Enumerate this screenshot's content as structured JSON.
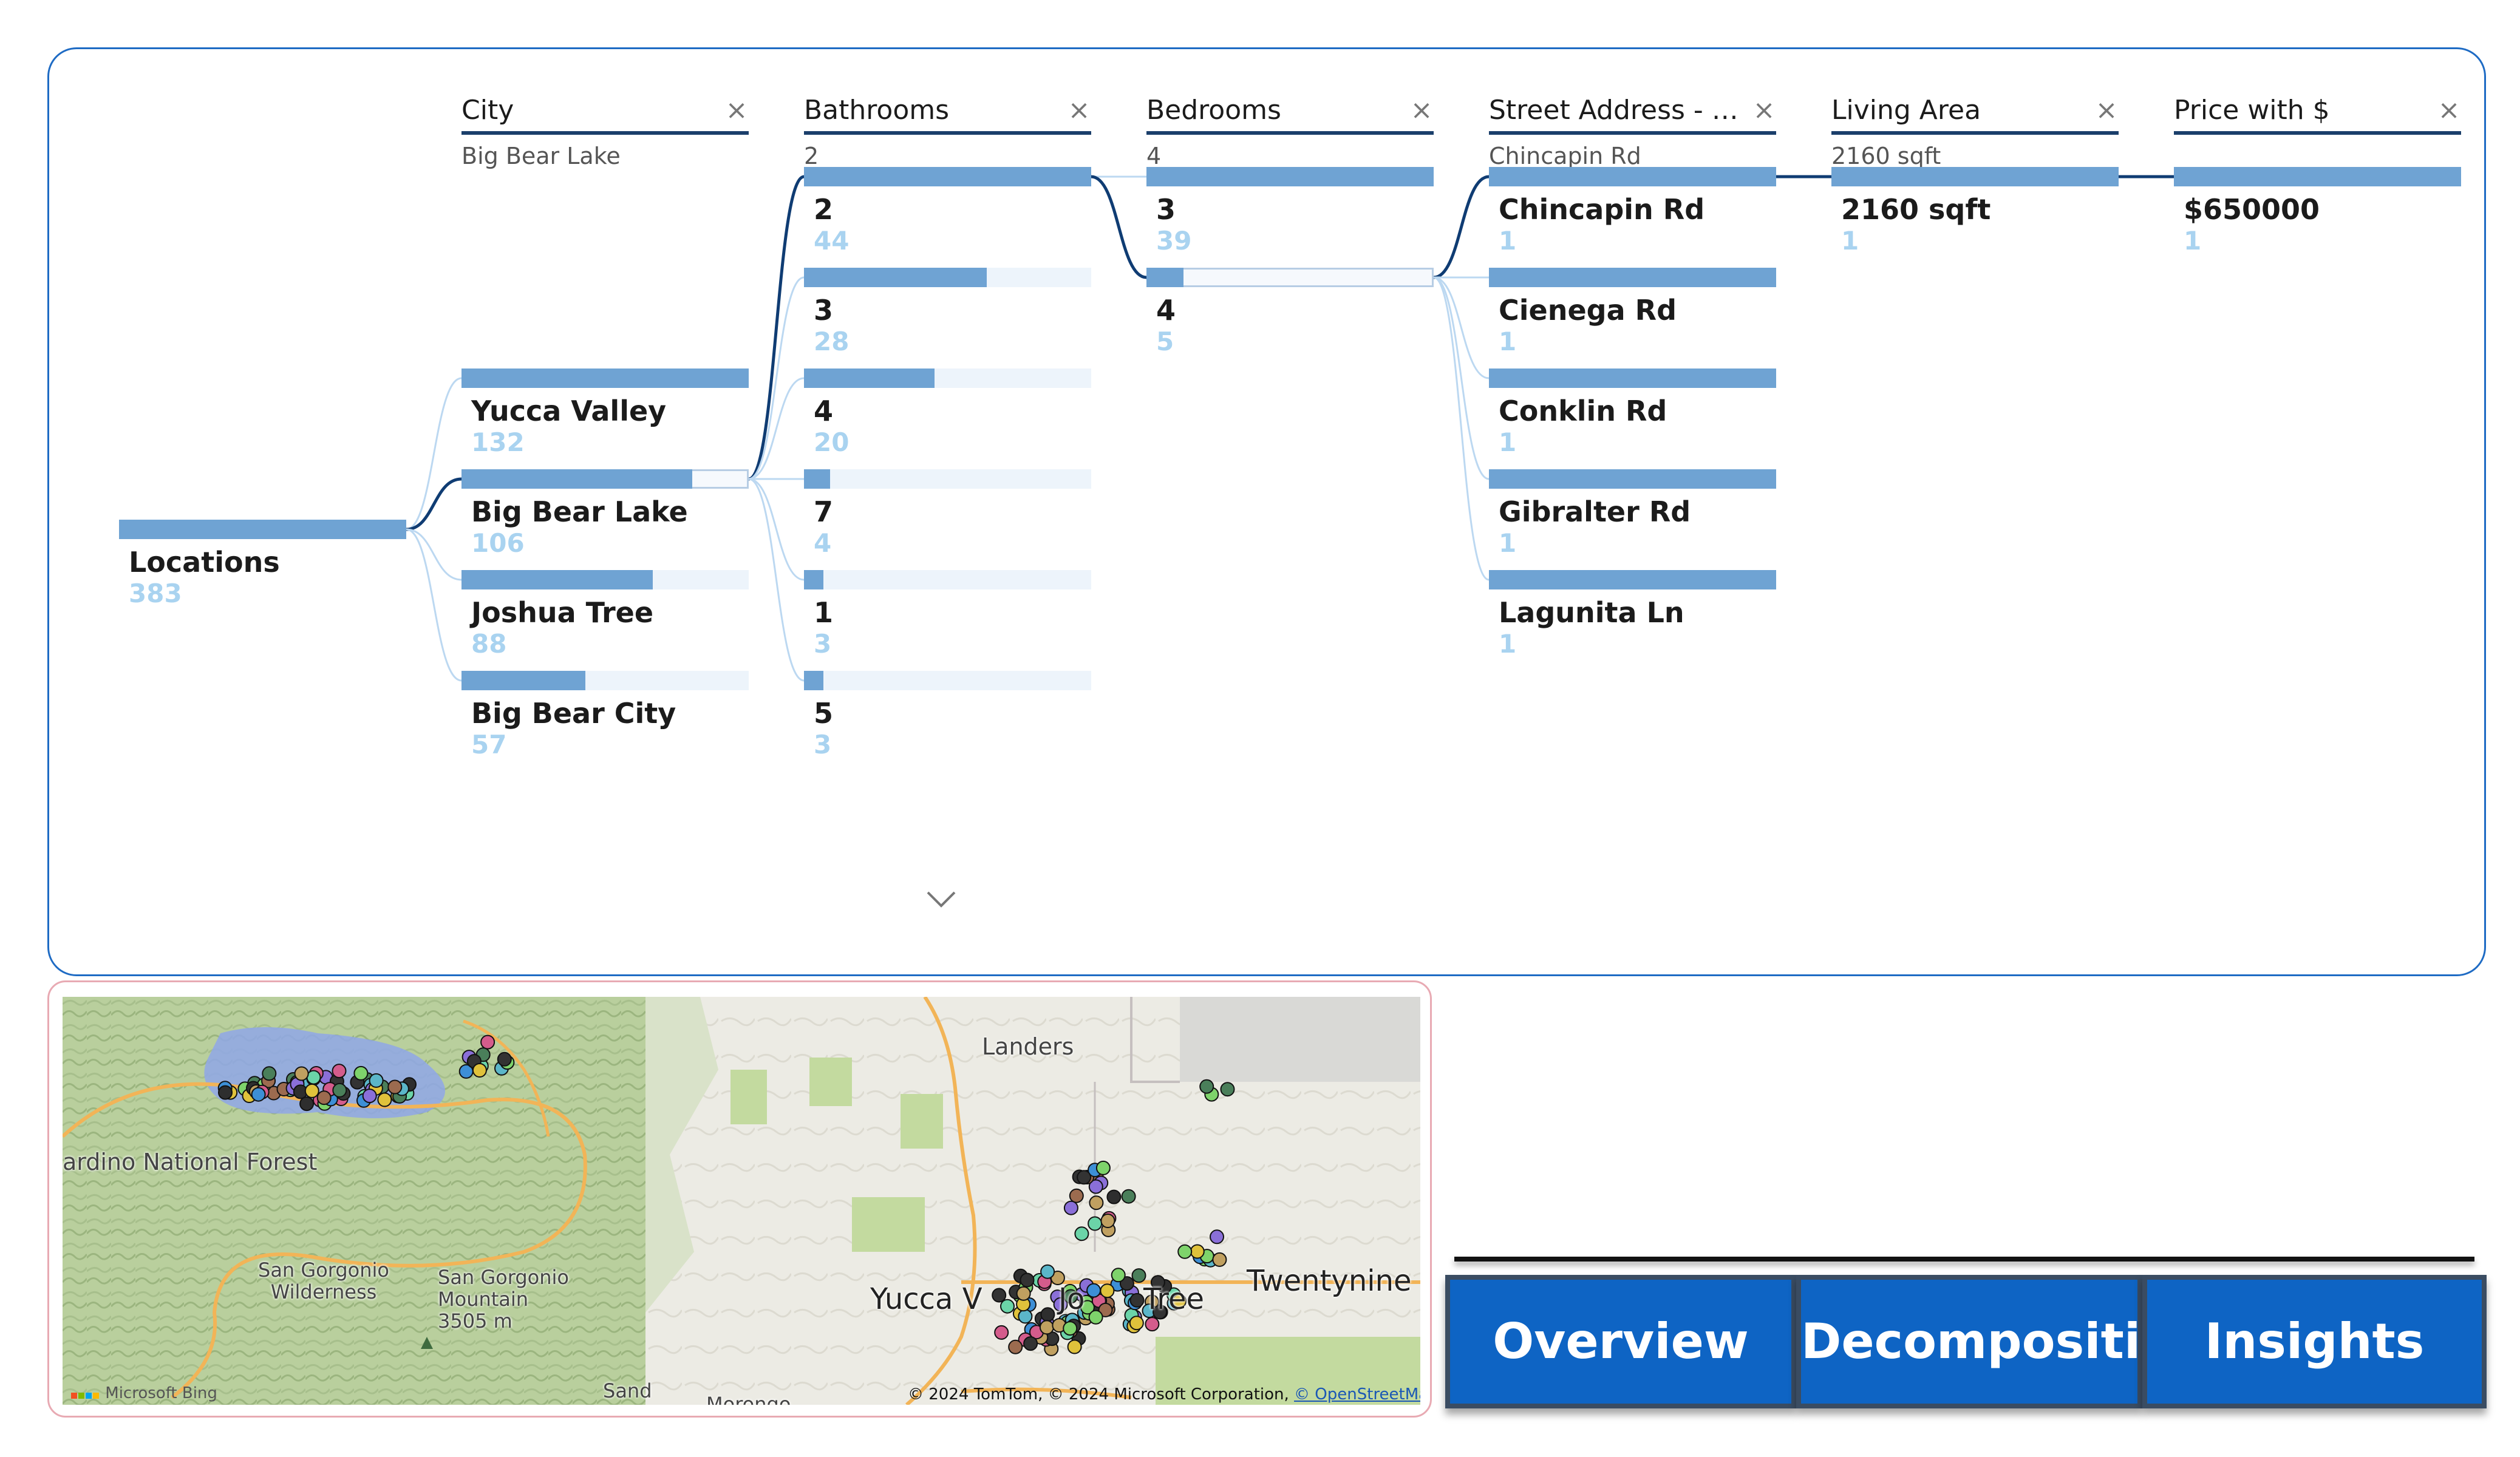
{
  "decomposition_tree": {
    "columns": [
      {
        "title": "City",
        "selected": "Big Bear Lake"
      },
      {
        "title": "Bathrooms",
        "selected": "2"
      },
      {
        "title": "Bedrooms",
        "selected": "4"
      },
      {
        "title": "Street Address - Na...",
        "selected": "Chincapin Rd"
      },
      {
        "title": "Living Area",
        "selected": "2160 sqft"
      },
      {
        "title": "Price with $",
        "selected": ""
      }
    ],
    "root": {
      "label": "Locations",
      "count": "383",
      "fill": 1.0
    },
    "levels": [
      [
        {
          "label": "Yucca Valley",
          "count": "132",
          "fill": 1.0
        },
        {
          "label": "Big Bear Lake",
          "count": "106",
          "fill": 0.803,
          "selected": true
        },
        {
          "label": "Joshua Tree",
          "count": "88",
          "fill": 0.667
        },
        {
          "label": "Big Bear City",
          "count": "57",
          "fill": 0.432
        }
      ],
      [
        {
          "label": "2",
          "count": "44",
          "fill": 1.0,
          "selected": true
        },
        {
          "label": "3",
          "count": "28",
          "fill": 0.636
        },
        {
          "label": "4",
          "count": "20",
          "fill": 0.455
        },
        {
          "label": "7",
          "count": "4",
          "fill": 0.091
        },
        {
          "label": "1",
          "count": "3",
          "fill": 0.068
        },
        {
          "label": "5",
          "count": "3",
          "fill": 0.068
        }
      ],
      [
        {
          "label": "3",
          "count": "39",
          "fill": 1.0
        },
        {
          "label": "4",
          "count": "5",
          "fill": 0.128,
          "selected": true
        }
      ],
      [
        {
          "label": "Chincapin Rd",
          "count": "1",
          "fill": 1.0,
          "selected": true
        },
        {
          "label": "Cienega Rd",
          "count": "1",
          "fill": 1.0
        },
        {
          "label": "Conklin Rd",
          "count": "1",
          "fill": 1.0
        },
        {
          "label": "Gibralter Rd",
          "count": "1",
          "fill": 1.0
        },
        {
          "label": "Lagunita Ln",
          "count": "1",
          "fill": 1.0
        }
      ],
      [
        {
          "label": "2160 sqft",
          "count": "1",
          "fill": 1.0,
          "selected": true
        }
      ],
      [
        {
          "label": "$650000",
          "count": "1",
          "fill": 1.0
        }
      ]
    ],
    "clear_icon": "x-icon",
    "expand_icon": "chevron-down-icon",
    "colors": {
      "bar": "#6fa3d3",
      "track": "#edf4fb",
      "count": "#a9d3f0",
      "path": "#0f3c73",
      "link": "#bcd8f1",
      "border": "#1e6bc4"
    }
  },
  "map": {
    "labels": [
      "Landers",
      "ardino National Forest",
      "San Gorgonio Wilderness",
      "San Gorgonio Mountain 3505 m",
      "Yucca V",
      "Jo",
      "Tree",
      "Twentynine P",
      "Sand",
      "Morongo"
    ],
    "copyright_text": "© 2024 TomTom, © 2024 Microsoft Corporation, ",
    "copyright_link": "© OpenStreetMap",
    "provider": "Microsoft Bing",
    "colors": {
      "terrain": "#cfdcb6",
      "forest": "#a8c58a",
      "desert": "#ecebe4",
      "road": "#f2b457",
      "water": "#8fa7e8",
      "park": "#bfd89d"
    }
  },
  "nav": {
    "buttons": [
      "Overview",
      "Decomposition",
      "Insights"
    ],
    "color": "#0e64c4"
  }
}
